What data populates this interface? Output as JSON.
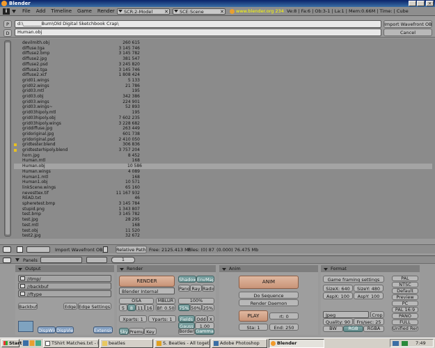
{
  "window": {
    "title": "Blender"
  },
  "menubar": {
    "menus": [
      "File",
      "Add",
      "Timeline",
      "Game",
      "Render",
      "Help"
    ],
    "screen_field": "SCR:2-Model",
    "scene_field": "SCE:Scene",
    "link": "www.blender.org 234",
    "stats": "Ve:8 | Fa:6 | Ob:3-1 | La:1 | Mem:0.66M | Time: | Cube"
  },
  "filebrowser": {
    "path": "d:\\________Burn\\Old Digital Sketchbook Crap\\",
    "filename": "Human.obj",
    "action_button": "Import Wavefront OBJ",
    "cancel_button": "Cancel",
    "p_button": "P",
    "d_button": "D",
    "files": [
      {
        "name": "devilmith.obj",
        "size": "260 615"
      },
      {
        "name": "diffuse.tga",
        "size": "3 145 746"
      },
      {
        "name": "diffuse2.bmp",
        "size": "3 145 782"
      },
      {
        "name": "diffuse2.jpg",
        "size": "381 547"
      },
      {
        "name": "diffuse2.psd",
        "size": "3 245 820"
      },
      {
        "name": "diffuse2.tga",
        "size": "3 145 746"
      },
      {
        "name": "diffuse2.xcf",
        "size": "1 808 424"
      },
      {
        "name": "grid01.wings",
        "size": "5 133"
      },
      {
        "name": "grid02.wings",
        "size": "21 786"
      },
      {
        "name": "grid03.mtl",
        "size": "195"
      },
      {
        "name": "grid03.obj",
        "size": "342 386"
      },
      {
        "name": "grid03.wings",
        "size": "224 901"
      },
      {
        "name": "grid03.wings~",
        "size": "52 893"
      },
      {
        "name": "grid03hipoly.mtl",
        "size": "195"
      },
      {
        "name": "grid03hipoly.obj",
        "size": "7 602 235"
      },
      {
        "name": "grid03hipoly.wings",
        "size": "3 228 682"
      },
      {
        "name": "griddiffuse.jpg",
        "size": "263 449"
      },
      {
        "name": "gridoriginal.jpg",
        "size": "601 738"
      },
      {
        "name": "gridoriginal.psd",
        "size": "2 410 050"
      },
      {
        "name": "gridtester.blend",
        "size": "306 836"
      },
      {
        "name": "gridtesterhipoly.blend",
        "size": "3 757 204"
      },
      {
        "name": "horn.jpg",
        "size": "8 452"
      },
      {
        "name": "Human.mtl",
        "size": "168"
      },
      {
        "name": "Human.obj",
        "size": "10 586"
      },
      {
        "name": "Human.wings",
        "size": "4 089"
      },
      {
        "name": "Human1.mtl",
        "size": "168"
      },
      {
        "name": "Human1.obj",
        "size": "10 571"
      },
      {
        "name": "linkScene.wings",
        "size": "65 160"
      },
      {
        "name": "nevesttex.tif",
        "size": "11 167 932"
      },
      {
        "name": "READ.txt",
        "size": "46"
      },
      {
        "name": "spheretest.bmp",
        "size": "3 145 784"
      },
      {
        "name": "stupid.png",
        "size": "1 343 807"
      },
      {
        "name": "test.bmp",
        "size": "3 145 782"
      },
      {
        "name": "test.jpg",
        "size": "28 295"
      },
      {
        "name": "test.mtl",
        "size": "168"
      },
      {
        "name": "test.obj",
        "size": "11 520"
      },
      {
        "name": "test2.jpg",
        "size": "32 672"
      }
    ],
    "selected_index": 23,
    "status": {
      "import_label": "Import Wavefront OBJ",
      "relative_paths": "Relative Paths",
      "free": "Free: 2125.413 Mb",
      "files": "Files: (0) 87",
      "selsize": "(0.000) 76.475 Mb"
    }
  },
  "panels_header": {
    "label": "Panels",
    "page": "1"
  },
  "output": {
    "title": "Output",
    "paths": [
      "//tmp/",
      "//backbuf",
      "//ftype"
    ],
    "backbuf": "Backbuf",
    "edge": "Edge",
    "edge_settings": "Edge Settings >>",
    "dispwin": "DispWin",
    "dispview": "DispView",
    "extensions": "Extensions"
  },
  "render": {
    "title": "Render",
    "render_button": "RENDER",
    "engine": "Blender Internal",
    "shadow": "Shadow",
    "envmap": "EnvMap",
    "pano": "Pano",
    "ray": "Ray",
    "radio": "Radio",
    "osa": "OSA",
    "osa_values": [
      "5",
      "8",
      "11",
      "16"
    ],
    "mblur": "MBLUR",
    "bf": "Bf: 0.50",
    "percent_100": "100%",
    "percent_options": [
      "75%",
      "50%",
      "25%"
    ],
    "xparts": "Xparts: 1",
    "yparts": "Yparts: 1",
    "fields": "Fields",
    "odd": "Odd",
    "x": "X",
    "gauss": "Gauss",
    "gauss_val": "1.00",
    "sky": "Sky",
    "premul": "Premul",
    "key": "Key",
    "border": "Border",
    "gamma": "Gamma"
  },
  "anim": {
    "title": "Anim",
    "anim_button": "ANIM",
    "do_sequence": "Do Sequence",
    "render_daemon": "Render Daemon",
    "play": "PLAY",
    "rt": "rt: 0",
    "sta": "Sta: 1",
    "end": "End: 250"
  },
  "format": {
    "title": "Format",
    "game_framing": "Game framing settings",
    "sizex": "SizeX: 640",
    "sizey": "SizeY: 480",
    "aspx": "AspX: 100",
    "aspy": "AspY: 100",
    "presets": [
      "PAL",
      "NTSC",
      "Default",
      "Preview",
      "PC",
      "PAL 16:9",
      "PANO",
      "FULL",
      "Unified Rende"
    ],
    "filetype": "Jpeg",
    "crop": "Crop",
    "quality": "Quality: 90",
    "fps": "Frs/sec: 25",
    "bw": "BW",
    "rgb": "RGB",
    "rgba": "RGBA"
  },
  "taskbar": {
    "start": "Start",
    "items": [
      "TShirt Matches.txt - Note...",
      "beatles",
      "S. Beatles - All together n...",
      "Adobe Photoshop",
      "Blender"
    ],
    "active_index": 4,
    "clock": "7:49 PM"
  },
  "colors": {
    "titlebar": "#0a246a",
    "panel_bg": "#9a9a9a",
    "list_bg": "#8b8b8b",
    "selected": "#a4a4a4"
  }
}
